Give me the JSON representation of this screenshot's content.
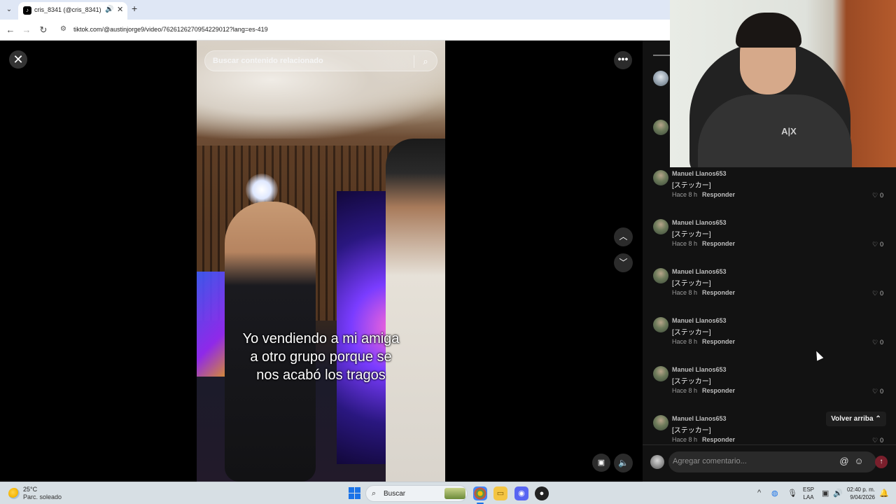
{
  "browser": {
    "tab_title": "cris_8341 (@cris_8341) | TikTok",
    "new_tab_icon": "plus-icon",
    "url": "tiktok.com/@austinjorge9/video/7626126270954229012?lang=es-419"
  },
  "video": {
    "search_placeholder": "Buscar contenido relacionado",
    "caption_line1": "Yo vendiendo a mi amiga",
    "caption_line2": "a otro grupo porque se",
    "caption_line3": "nos acabó los tragos"
  },
  "comments": {
    "items": [
      {
        "user": "Manuel Llanos653",
        "text": "[ステッカー]",
        "time": "Hace 8 h",
        "reply": "Responder",
        "likes": "0"
      },
      {
        "user": "Manuel Llanos653",
        "text": "[ステッカー]",
        "time": "Hace 8 h",
        "reply": "Responder",
        "likes": "0"
      },
      {
        "user": "Manuel Llanos653",
        "text": "[ステッカー]",
        "time": "Hace 8 h",
        "reply": "Responder",
        "likes": "0"
      },
      {
        "user": "Manuel Llanos653",
        "text": "[ステッカー]",
        "time": "Hace 8 h",
        "reply": "Responder",
        "likes": "0"
      },
      {
        "user": "Manuel Llanos653",
        "text": "[ステッカー]",
        "time": "Hace 8 h",
        "reply": "Responder",
        "likes": "0"
      },
      {
        "user": "Manuel Llanos653",
        "text": "[ステッカー]",
        "time": "Hace 8 h",
        "reply": "Responder",
        "likes": "0"
      }
    ],
    "back_to_top": "Volver arriba",
    "input_placeholder": "Agregar comentario..."
  },
  "taskbar": {
    "weather_temp": "25°C",
    "weather_desc": "Parc. soleado",
    "search_label": "Buscar",
    "lang_line1": "ESP",
    "lang_line2": "LAA",
    "time": "02:40 p. m.",
    "date": "9/04/2026"
  },
  "colors": {
    "panel_bg": "#121212",
    "send_button": "#7a1f2c",
    "accent_blue": "#1a73e8"
  }
}
